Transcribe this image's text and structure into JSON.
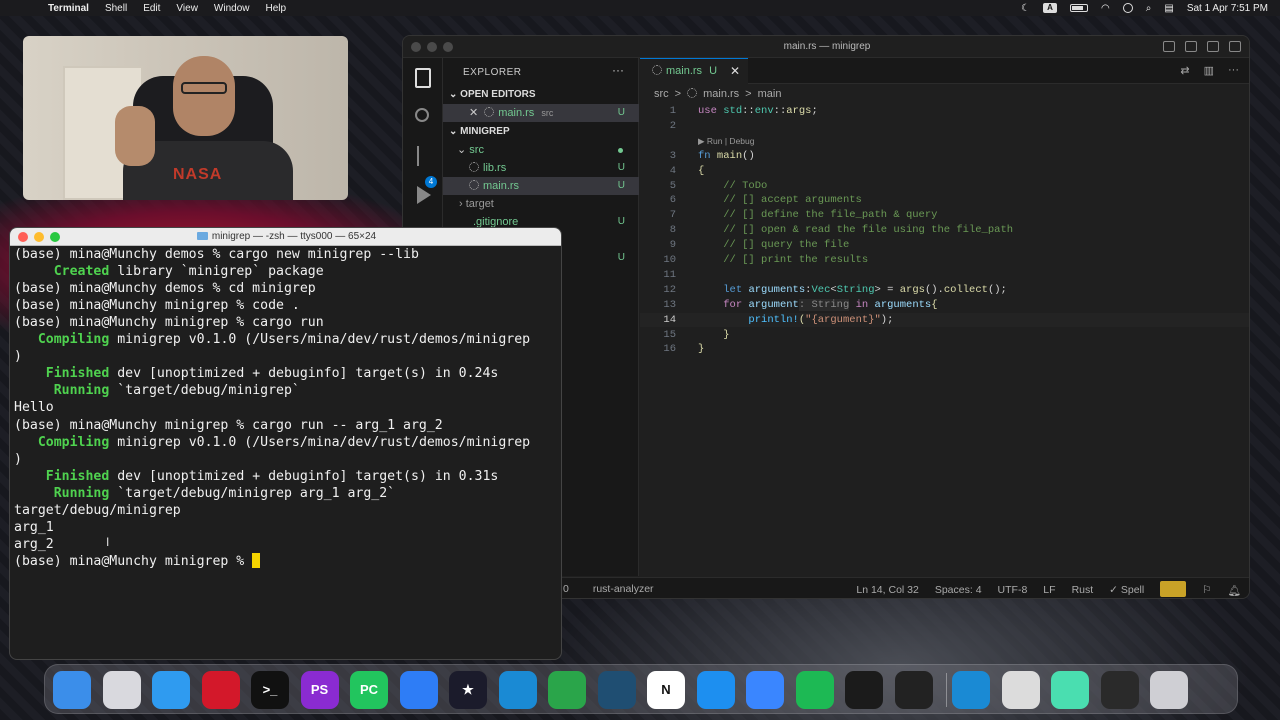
{
  "menubar": {
    "app": "Terminal",
    "items": [
      "Shell",
      "Edit",
      "View",
      "Window",
      "Help"
    ],
    "clock": "Sat 1 Apr  7:51 PM",
    "input_indicator": "A"
  },
  "webcam": {
    "shirt_text": "NASA"
  },
  "vscode": {
    "title": "main.rs — minigrep",
    "explorer_label": "EXPLORER",
    "open_editors_label": "OPEN EDITORS",
    "open_editor_file": "main.rs",
    "open_editor_dir": "src",
    "open_editor_status": "U",
    "project_label": "MINIGREP",
    "tree": [
      {
        "name": "src",
        "status": ""
      },
      {
        "name": "lib.rs",
        "status": "U"
      },
      {
        "name": "main.rs",
        "status": "U"
      },
      {
        "name": "target",
        "status": ""
      },
      {
        "name": ".gitignore",
        "status": "U"
      },
      {
        "name": "",
        "status": "U"
      }
    ],
    "scm_badge": "4",
    "tab": {
      "label": "main.rs",
      "status": "U"
    },
    "breadcrumbs": [
      "src",
      ">",
      "main.rs",
      ">",
      "main"
    ],
    "codelens": "Run | Debug",
    "line_numbers": [
      "1",
      "2",
      "3",
      "4",
      "5",
      "6",
      "7",
      "8",
      "9",
      "10",
      "11",
      "12",
      "13",
      "14",
      "15",
      "16"
    ],
    "code": {
      "l1_use": "use",
      "l1_std": "std",
      "l1_sep1": "::",
      "l1_env": "env",
      "l1_sep2": "::",
      "l1_args": "args",
      "l1_end": ";",
      "l3_fn": "fn",
      "l3_main": "main",
      "l3_parens": "()",
      "l4": "{",
      "l5": "// ToDo",
      "l6": "// [] accept arguments",
      "l7": "// [] define the file_path & query",
      "l8": "// [] open & read the file using the file_path",
      "l9": "// [] query the file",
      "l10": "// [] print the results",
      "l12_let": "let",
      "l12_var": "arguments",
      "l12_colon": ":",
      "l12_vec": "Vec",
      "l12_lt": "<",
      "l12_string": "String",
      "l12_gt": ">",
      "l12_eq": " = ",
      "l12_args": "args",
      "l12_p1": "().",
      "l12_collect": "collect",
      "l12_end": "();",
      "l13_for": "for",
      "l13_var": "argument",
      "l13_hint": ": String",
      "l13_in": "in",
      "l13_iter": "arguments",
      "l13_brace": "{",
      "l14_macro": "println!",
      "l14_open": "(",
      "l14_str": "\"{argument}\"",
      "l14_end": ");",
      "l15": "}",
      "l16": "}"
    },
    "status_left": [
      "0",
      "rust-analyzer"
    ],
    "status_right": [
      "Ln 14, Col 32",
      "Spaces: 4",
      "UTF-8",
      "LF",
      "Rust",
      "✓ Spell"
    ]
  },
  "terminal": {
    "title": "minigrep — -zsh — ttys000 — 65×24",
    "lines": [
      {
        "a": "",
        "g": "",
        "b": "(base) mina@Munchy demos % cargo new minigrep --lib"
      },
      {
        "a": "     ",
        "g": "Created",
        "b": " library `minigrep` package"
      },
      {
        "a": "",
        "g": "",
        "b": "(base) mina@Munchy demos % cd minigrep"
      },
      {
        "a": "",
        "g": "",
        "b": "(base) mina@Munchy minigrep % code ."
      },
      {
        "a": "",
        "g": "",
        "b": "(base) mina@Munchy minigrep % cargo run"
      },
      {
        "a": "   ",
        "g": "Compiling",
        "b": " minigrep v0.1.0 (/Users/mina/dev/rust/demos/minigrep"
      },
      {
        "a": "",
        "g": "",
        "b": ")"
      },
      {
        "a": "    ",
        "g": "Finished",
        "b": " dev [unoptimized + debuginfo] target(s) in 0.24s"
      },
      {
        "a": "     ",
        "g": "Running",
        "b": " `target/debug/minigrep`"
      },
      {
        "a": "",
        "g": "",
        "b": "Hello"
      },
      {
        "a": "",
        "g": "",
        "b": "(base) mina@Munchy minigrep % cargo run -- arg_1 arg_2"
      },
      {
        "a": "   ",
        "g": "Compiling",
        "b": " minigrep v0.1.0 (/Users/mina/dev/rust/demos/minigrep"
      },
      {
        "a": "",
        "g": "",
        "b": ")"
      },
      {
        "a": "    ",
        "g": "Finished",
        "b": " dev [unoptimized + debuginfo] target(s) in 0.31s"
      },
      {
        "a": "     ",
        "g": "Running",
        "b": " `target/debug/minigrep arg_1 arg_2`"
      },
      {
        "a": "",
        "g": "",
        "b": "target/debug/minigrep"
      },
      {
        "a": "",
        "g": "",
        "b": "arg_1"
      },
      {
        "a": "",
        "g": "",
        "b": "arg_2"
      },
      {
        "a": "",
        "g": "",
        "b": "(base) mina@Munchy minigrep % "
      }
    ]
  },
  "dock": {
    "apps": [
      {
        "name": "finder-icon",
        "label": "",
        "color": "#3b8eea"
      },
      {
        "name": "launchpad-icon",
        "label": "",
        "color": "#d9d9de"
      },
      {
        "name": "safari-icon",
        "label": "",
        "color": "#2f9bf0"
      },
      {
        "name": "opera-icon",
        "label": "",
        "color": "#d3182a"
      },
      {
        "name": "terminal-icon",
        "label": ">_",
        "color": "#111111"
      },
      {
        "name": "phpstorm-icon",
        "label": "PS",
        "color": "#8a2bd1"
      },
      {
        "name": "pycharm-icon",
        "label": "PC",
        "color": "#22c55e"
      },
      {
        "name": "xcode-icon",
        "label": "",
        "color": "#2e7df6"
      },
      {
        "name": "app-star-icon",
        "label": "★",
        "color": "#1b1b2b"
      },
      {
        "name": "vscode-icon",
        "label": "",
        "color": "#1a8ad4"
      },
      {
        "name": "green-ring-icon",
        "label": "",
        "color": "#2aa54a"
      },
      {
        "name": "mysql-workbench-icon",
        "label": "",
        "color": "#1f4e72"
      },
      {
        "name": "notion-icon",
        "label": "N",
        "color": "#ffffff"
      },
      {
        "name": "docker-icon",
        "label": "",
        "color": "#1d8ff0"
      },
      {
        "name": "arc-icon",
        "label": "",
        "color": "#3a86ff"
      },
      {
        "name": "spotify-icon",
        "label": "",
        "color": "#1db954"
      },
      {
        "name": "flask-app-icon",
        "label": "",
        "color": "#1b1b1b"
      },
      {
        "name": "zed-icon",
        "label": "",
        "color": "#222222"
      },
      {
        "name": "vscode-2-icon",
        "label": "",
        "color": "#1a8ad4"
      },
      {
        "name": "quicktime-icon",
        "label": "",
        "color": "#dcdcdc"
      },
      {
        "name": "discord-like-icon",
        "label": "",
        "color": "#4adeb0"
      },
      {
        "name": "terminal-window-icon",
        "label": "",
        "color": "#2a2a2a"
      },
      {
        "name": "trash-icon",
        "label": "",
        "color": "#cfcfd4"
      }
    ]
  }
}
